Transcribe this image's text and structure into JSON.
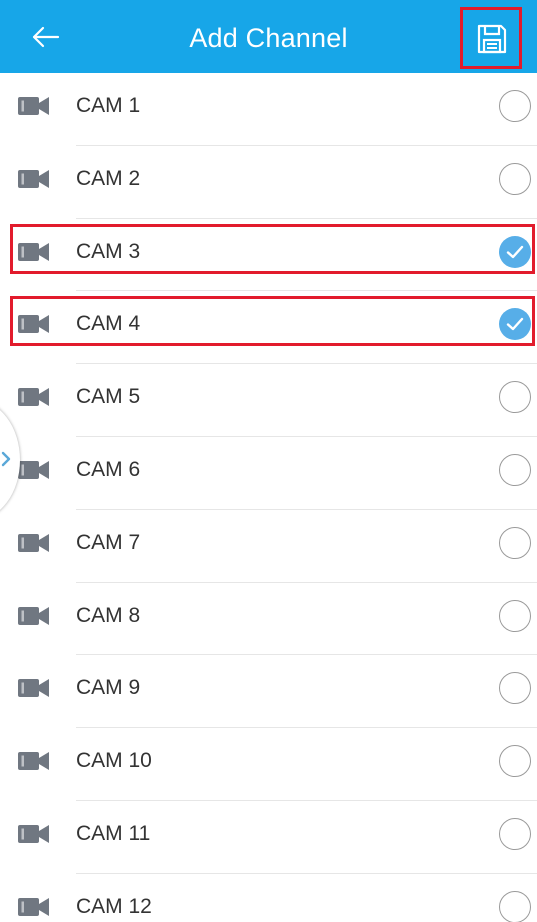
{
  "header": {
    "title": "Add Channel",
    "back_icon": "arrow-left-icon",
    "save_icon": "floppy-disk-icon"
  },
  "colors": {
    "topbar": "#17a6e8",
    "check": "#57aee8",
    "highlight": "#e21b2c",
    "icon": "#707781"
  },
  "channels": [
    {
      "label": "CAM 1",
      "checked": false
    },
    {
      "label": "CAM 2",
      "checked": false
    },
    {
      "label": "CAM 3",
      "checked": true
    },
    {
      "label": "CAM 4",
      "checked": true
    },
    {
      "label": "CAM 5",
      "checked": false
    },
    {
      "label": "CAM 6",
      "checked": false
    },
    {
      "label": "CAM 7",
      "checked": false
    },
    {
      "label": "CAM 8",
      "checked": false
    },
    {
      "label": "CAM 9",
      "checked": false
    },
    {
      "label": "CAM 10",
      "checked": false
    },
    {
      "label": "CAM 11",
      "checked": false
    },
    {
      "label": "CAM 12",
      "checked": false
    }
  ]
}
